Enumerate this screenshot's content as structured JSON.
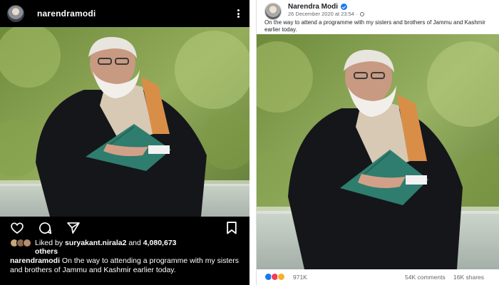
{
  "instagram": {
    "username": "narendramodi",
    "liked_by_prefix": "Liked by ",
    "liked_by_user": "suryakant.nirala2",
    "liked_by_and": " and ",
    "liked_by_count": "4,080,673",
    "liked_by_suffix": "others",
    "caption_user": "narendramodi",
    "caption_text": " On the way to attending a programme with my sisters and brothers of Jammu and Kashmir earlier today.",
    "icons": {
      "more": "more-vertical-icon",
      "like": "heart-icon",
      "comment": "comment-icon",
      "share": "send-icon",
      "save": "bookmark-icon"
    }
  },
  "facebook": {
    "page_name": "Narendra Modi",
    "timestamp": "26 December 2020 at 23:54 · ",
    "caption": "On the way to attend a programme with my sisters and brothers of Jammu and Kashmir earlier today.",
    "reactions_count": "971K",
    "comments": "54K comments",
    "shares": "16K shares",
    "icons": {
      "verified": "verified-badge-icon",
      "privacy": "globe-icon",
      "reactions": [
        "like-reaction-icon",
        "love-reaction-icon",
        "care-reaction-icon"
      ]
    }
  },
  "colors": {
    "instagram_bg": "#000000",
    "facebook_accent": "#1877f2",
    "facebook_text_secondary": "#65676b"
  }
}
